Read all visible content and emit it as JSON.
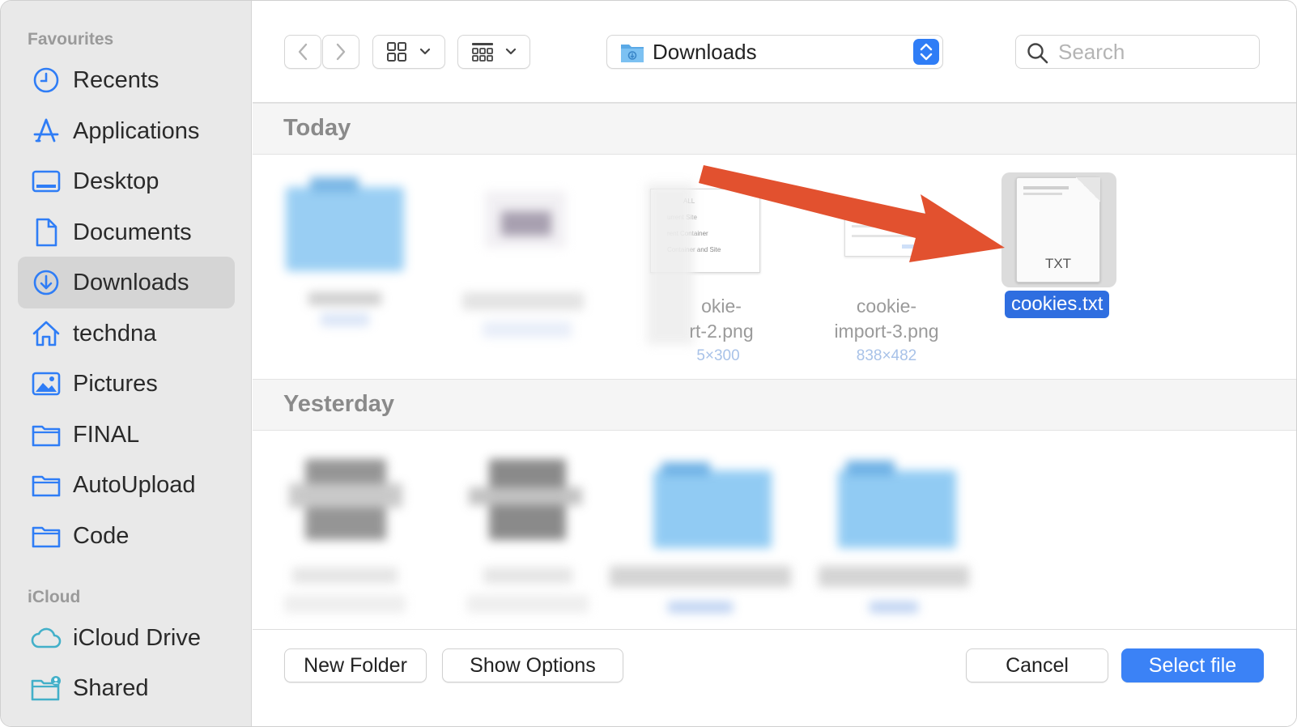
{
  "sidebar": {
    "favourites_label": "Favourites",
    "items": [
      {
        "label": "Recents",
        "icon": "clock-icon"
      },
      {
        "label": "Applications",
        "icon": "applications-icon"
      },
      {
        "label": "Desktop",
        "icon": "desktop-icon"
      },
      {
        "label": "Documents",
        "icon": "document-icon"
      },
      {
        "label": "Downloads",
        "icon": "download-icon",
        "selected": true
      },
      {
        "label": "techdna",
        "icon": "home-icon"
      },
      {
        "label": "Pictures",
        "icon": "pictures-icon"
      },
      {
        "label": "FINAL",
        "icon": "folder-icon"
      },
      {
        "label": "AutoUpload",
        "icon": "folder-icon"
      },
      {
        "label": "Code",
        "icon": "folder-icon"
      }
    ],
    "icloud_label": "iCloud",
    "icloud_items": [
      {
        "label": "iCloud Drive",
        "icon": "cloud-icon"
      },
      {
        "label": "Shared",
        "icon": "shared-folder-icon"
      }
    ]
  },
  "toolbar": {
    "location": "Downloads",
    "search_placeholder": "Search"
  },
  "groups": {
    "today": "Today",
    "yesterday": "Yesterday"
  },
  "files_today": [
    {
      "name_line1": "okie-",
      "name_line2": "rt-2.png",
      "dims": "5×300"
    },
    {
      "name_line1": "cookie-",
      "name_line2": "import-3.png",
      "dims": "838×482"
    },
    {
      "name": "cookies.txt",
      "ext": "TXT",
      "selected": true
    }
  ],
  "footer": {
    "new_folder": "New Folder",
    "show_options": "Show Options",
    "cancel": "Cancel",
    "select_file": "Select file"
  },
  "colors": {
    "accent": "#3b82f6",
    "annotation_arrow": "#e2512f",
    "icon_blue": "#2f7df6"
  }
}
